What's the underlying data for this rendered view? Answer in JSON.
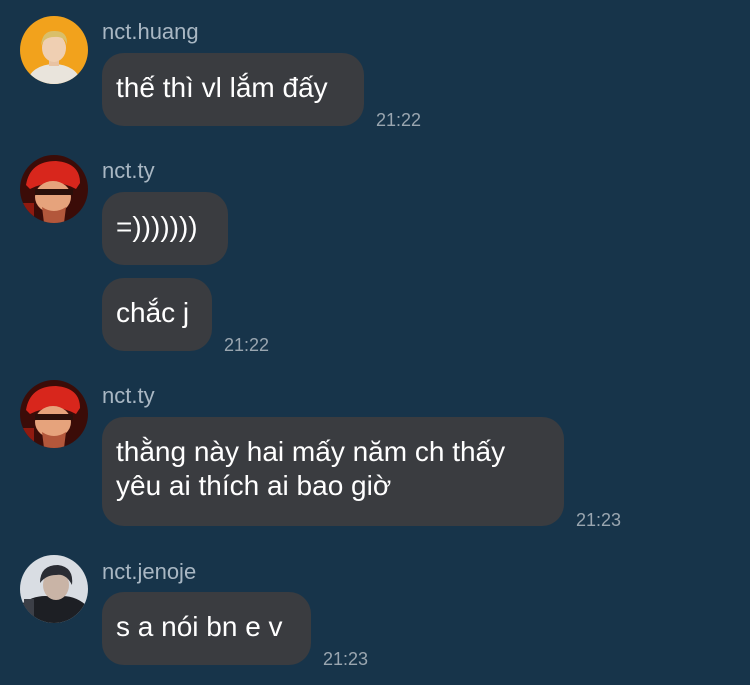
{
  "messages": [
    {
      "username": "nct.huang",
      "bubbles": [
        "thế thì vl lắm đấy"
      ],
      "time": "21:22"
    },
    {
      "username": "nct.ty",
      "bubbles": [
        "=)))))))",
        "chắc j"
      ],
      "time": "21:22"
    },
    {
      "username": "nct.ty",
      "bubbles": [
        "thằng này hai mấy năm ch thấy",
        "yêu ai thích ai bao giờ"
      ],
      "time": "21:23"
    },
    {
      "username": "nct.jenoje",
      "bubbles": [
        "s a nói bn e v"
      ],
      "time": "21:23"
    }
  ],
  "colors": {
    "background": "#17344a",
    "bubble": "#3a3c40",
    "username": "#a9b7c3",
    "timestamp": "#9aa6b0"
  }
}
